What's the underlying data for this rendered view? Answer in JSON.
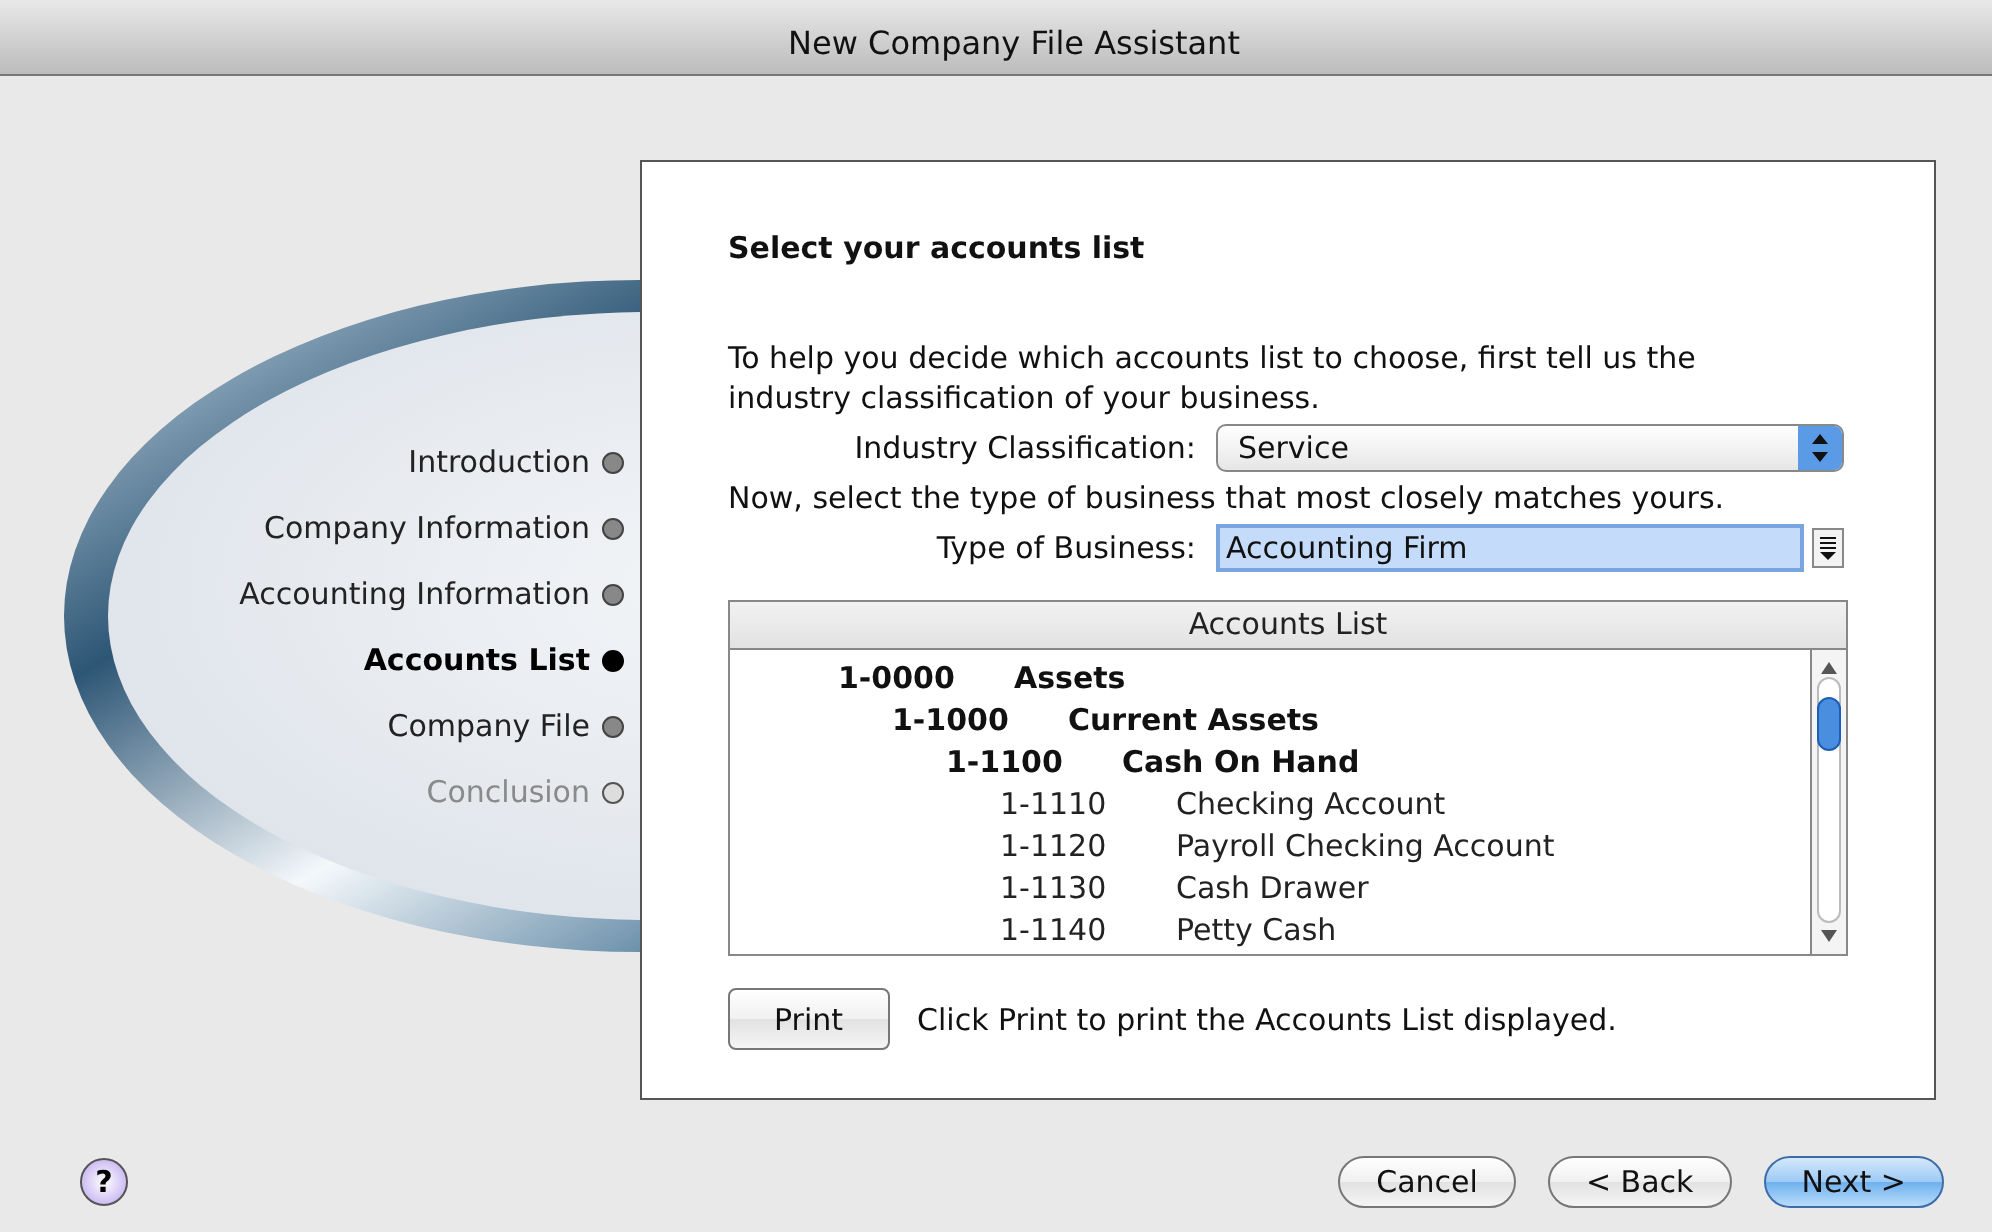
{
  "window": {
    "title": "New Company File Assistant"
  },
  "steps": [
    {
      "label": "Introduction",
      "selected": false,
      "disabled": false
    },
    {
      "label": "Company Information",
      "selected": false,
      "disabled": false
    },
    {
      "label": "Accounting Information",
      "selected": false,
      "disabled": false
    },
    {
      "label": "Accounts List",
      "selected": true,
      "disabled": false
    },
    {
      "label": "Company File",
      "selected": false,
      "disabled": false
    },
    {
      "label": "Conclusion",
      "selected": false,
      "disabled": true
    }
  ],
  "heading": "Select your accounts list",
  "intro": "To help you decide which accounts list to choose, first tell us the industry classification of your business.",
  "industry": {
    "label": "Industry Classification:",
    "value": "Service"
  },
  "instruction": "Now, select the type of business that most closely matches yours.",
  "business_type": {
    "label": "Type of Business:",
    "value": "Accounting Firm"
  },
  "accounts_list": {
    "header": "Accounts List",
    "items": [
      {
        "number": "1-0000",
        "name": "Assets",
        "children": [
          {
            "number": "1-1000",
            "name": "Current Assets",
            "children": [
              {
                "number": "1-1100",
                "name": "Cash On Hand",
                "children": [
                  {
                    "number": "1-1110",
                    "name": "Checking Account"
                  },
                  {
                    "number": "1-1120",
                    "name": "Payroll Checking Account"
                  },
                  {
                    "number": "1-1130",
                    "name": "Cash Drawer"
                  },
                  {
                    "number": "1-1140",
                    "name": "Petty Cash"
                  }
                ]
              }
            ]
          }
        ]
      }
    ]
  },
  "print": {
    "button": "Print",
    "hint": "Click Print to print the Accounts List displayed."
  },
  "buttons": [
    {
      "label": "Cancel",
      "default": false
    },
    {
      "label": "< Back",
      "default": false
    },
    {
      "label": "Next >",
      "default": true
    }
  ],
  "help": "?"
}
